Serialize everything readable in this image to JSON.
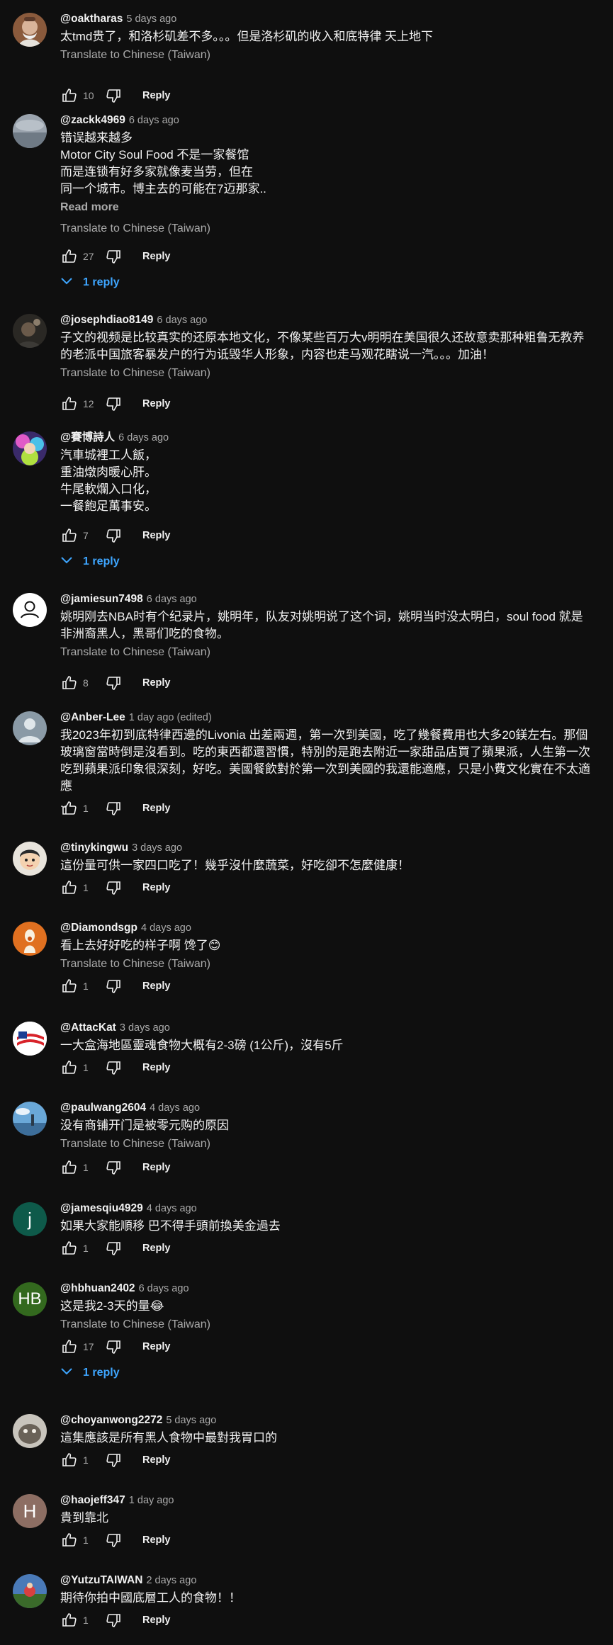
{
  "labels": {
    "reply": "Reply",
    "translate": "Translate to Chinese (Taiwan)",
    "read_more": "Read more"
  },
  "colors": {
    "background": "#0f0f0f",
    "link_blue": "#3ea6ff",
    "muted": "#aaaaaa"
  },
  "comments": [
    {
      "handle": "@oaktharas",
      "time": "5 days ago",
      "text": "太tmd贵了，和洛杉矶差不多。。。但是洛杉矶的收入和底特律 天上地下",
      "translate": true,
      "likes": "10",
      "avatar": "photo-man-beard"
    },
    {
      "handle": "@zackk4969",
      "time": "6 days ago",
      "text": "错误越来越多\nMotor City Soul Food 不是一家餐馆\n而是连锁有好多家就像麦当劳，但在\n同一个城市。博主去的可能在7迈那家..",
      "read_more": true,
      "translate": true,
      "likes": "27",
      "replies": "1 reply",
      "avatar": "photo-gray-sky"
    },
    {
      "handle": "@josephdiao8149",
      "time": "6 days ago",
      "text": "子文的视频是比较真实的还原本地文化，不像某些百万大v明明在美国很久还故意卖那种粗鲁无教养的老派中国旅客暴发户的行为诋毁华人形象，内容也走马观花瞎说一汽。。。加油！",
      "translate": true,
      "likes": "12",
      "avatar": "photo-dark-portrait"
    },
    {
      "handle": "@賽博詩人",
      "time": "6 days ago",
      "text": "汽車城裡工人飯，\n重油燉肉暖心肝。\n牛尾軟爛入口化，\n一餐飽足萬事安。",
      "likes": "7",
      "replies": "1 reply",
      "avatar": "anime-colorful"
    },
    {
      "handle": "@jamiesun7498",
      "time": "6 days ago",
      "text": "姚明刚去NBA时有个纪录片，姚明年，队友对姚明说了这个词，姚明当时没太明白，soul food 就是非洲裔黑人，黑哥们吃的食物。",
      "translate": true,
      "likes": "8",
      "avatar": "default-person-white"
    },
    {
      "handle": "@Anber-Lee",
      "time": "1 day ago (edited)",
      "text": "我2023年初到底特律西邊的Livonia 出差兩週，第一次到美國，吃了幾餐費用也大多20鎂左右。那個玻璃窗當時倒是沒看到。吃的東西都還習慣，特別的是跑去附近一家甜品店買了蘋果派，人生第一次吃到蘋果派印象很深刻，好吃。美國餐飲對於第一次到美國的我還能適應，只是小費文化實在不太適應\n..",
      "likes": "1",
      "avatar": "default-person-gray"
    },
    {
      "handle": "@tinykingwu",
      "time": "3 days ago",
      "text": "這份量可供一家四口吃了！幾乎沒什麼蔬菜，好吃卻不怎麼健康！",
      "likes": "1",
      "avatar": "cartoon-boy"
    },
    {
      "handle": "@Diamondsgp",
      "time": "4 days ago",
      "text": "看上去好好吃的样子啊 馋了😊",
      "translate": true,
      "likes": "1",
      "avatar": "orange-figure"
    },
    {
      "handle": "@AttacKat",
      "time": "3 days ago",
      "text": "一大盒海地區靈魂食物大概有2-3磅 (1公斤)，沒有5斤",
      "likes": "1",
      "avatar": "flag-white"
    },
    {
      "handle": "@paulwang2604",
      "time": "4 days ago",
      "text": "没有商铺开门是被零元购的原因",
      "translate": true,
      "likes": "1",
      "avatar": "photo-sky-landscape"
    },
    {
      "handle": "@jamesqiu4929",
      "time": "4 days ago",
      "text": "如果大家能順移 巴不得手頭前換美金過去",
      "likes": "1",
      "avatar": "letter-j",
      "letter": "j"
    },
    {
      "handle": "@hbhuan2402",
      "time": "6 days ago",
      "text": "这是我2-3天的量😂",
      "translate": true,
      "likes": "17",
      "replies": "1 reply",
      "avatar": "letters-hb",
      "letter": "HB"
    },
    {
      "handle": "@choyanwong2272",
      "time": "5 days ago",
      "text": "這集應該是所有黑人食物中最對我胃口的",
      "likes": "1",
      "avatar": "photo-animal"
    },
    {
      "handle": "@haojeff347",
      "time": "1 day ago",
      "text": "貴到靠北",
      "likes": "1",
      "avatar": "letter-h",
      "letter": "H"
    },
    {
      "handle": "@YutzuTAIWAN",
      "time": "2 days ago",
      "text": "期待你拍中國底層工人的食物！！",
      "likes": "1",
      "avatar": "photo-outdoor"
    }
  ]
}
